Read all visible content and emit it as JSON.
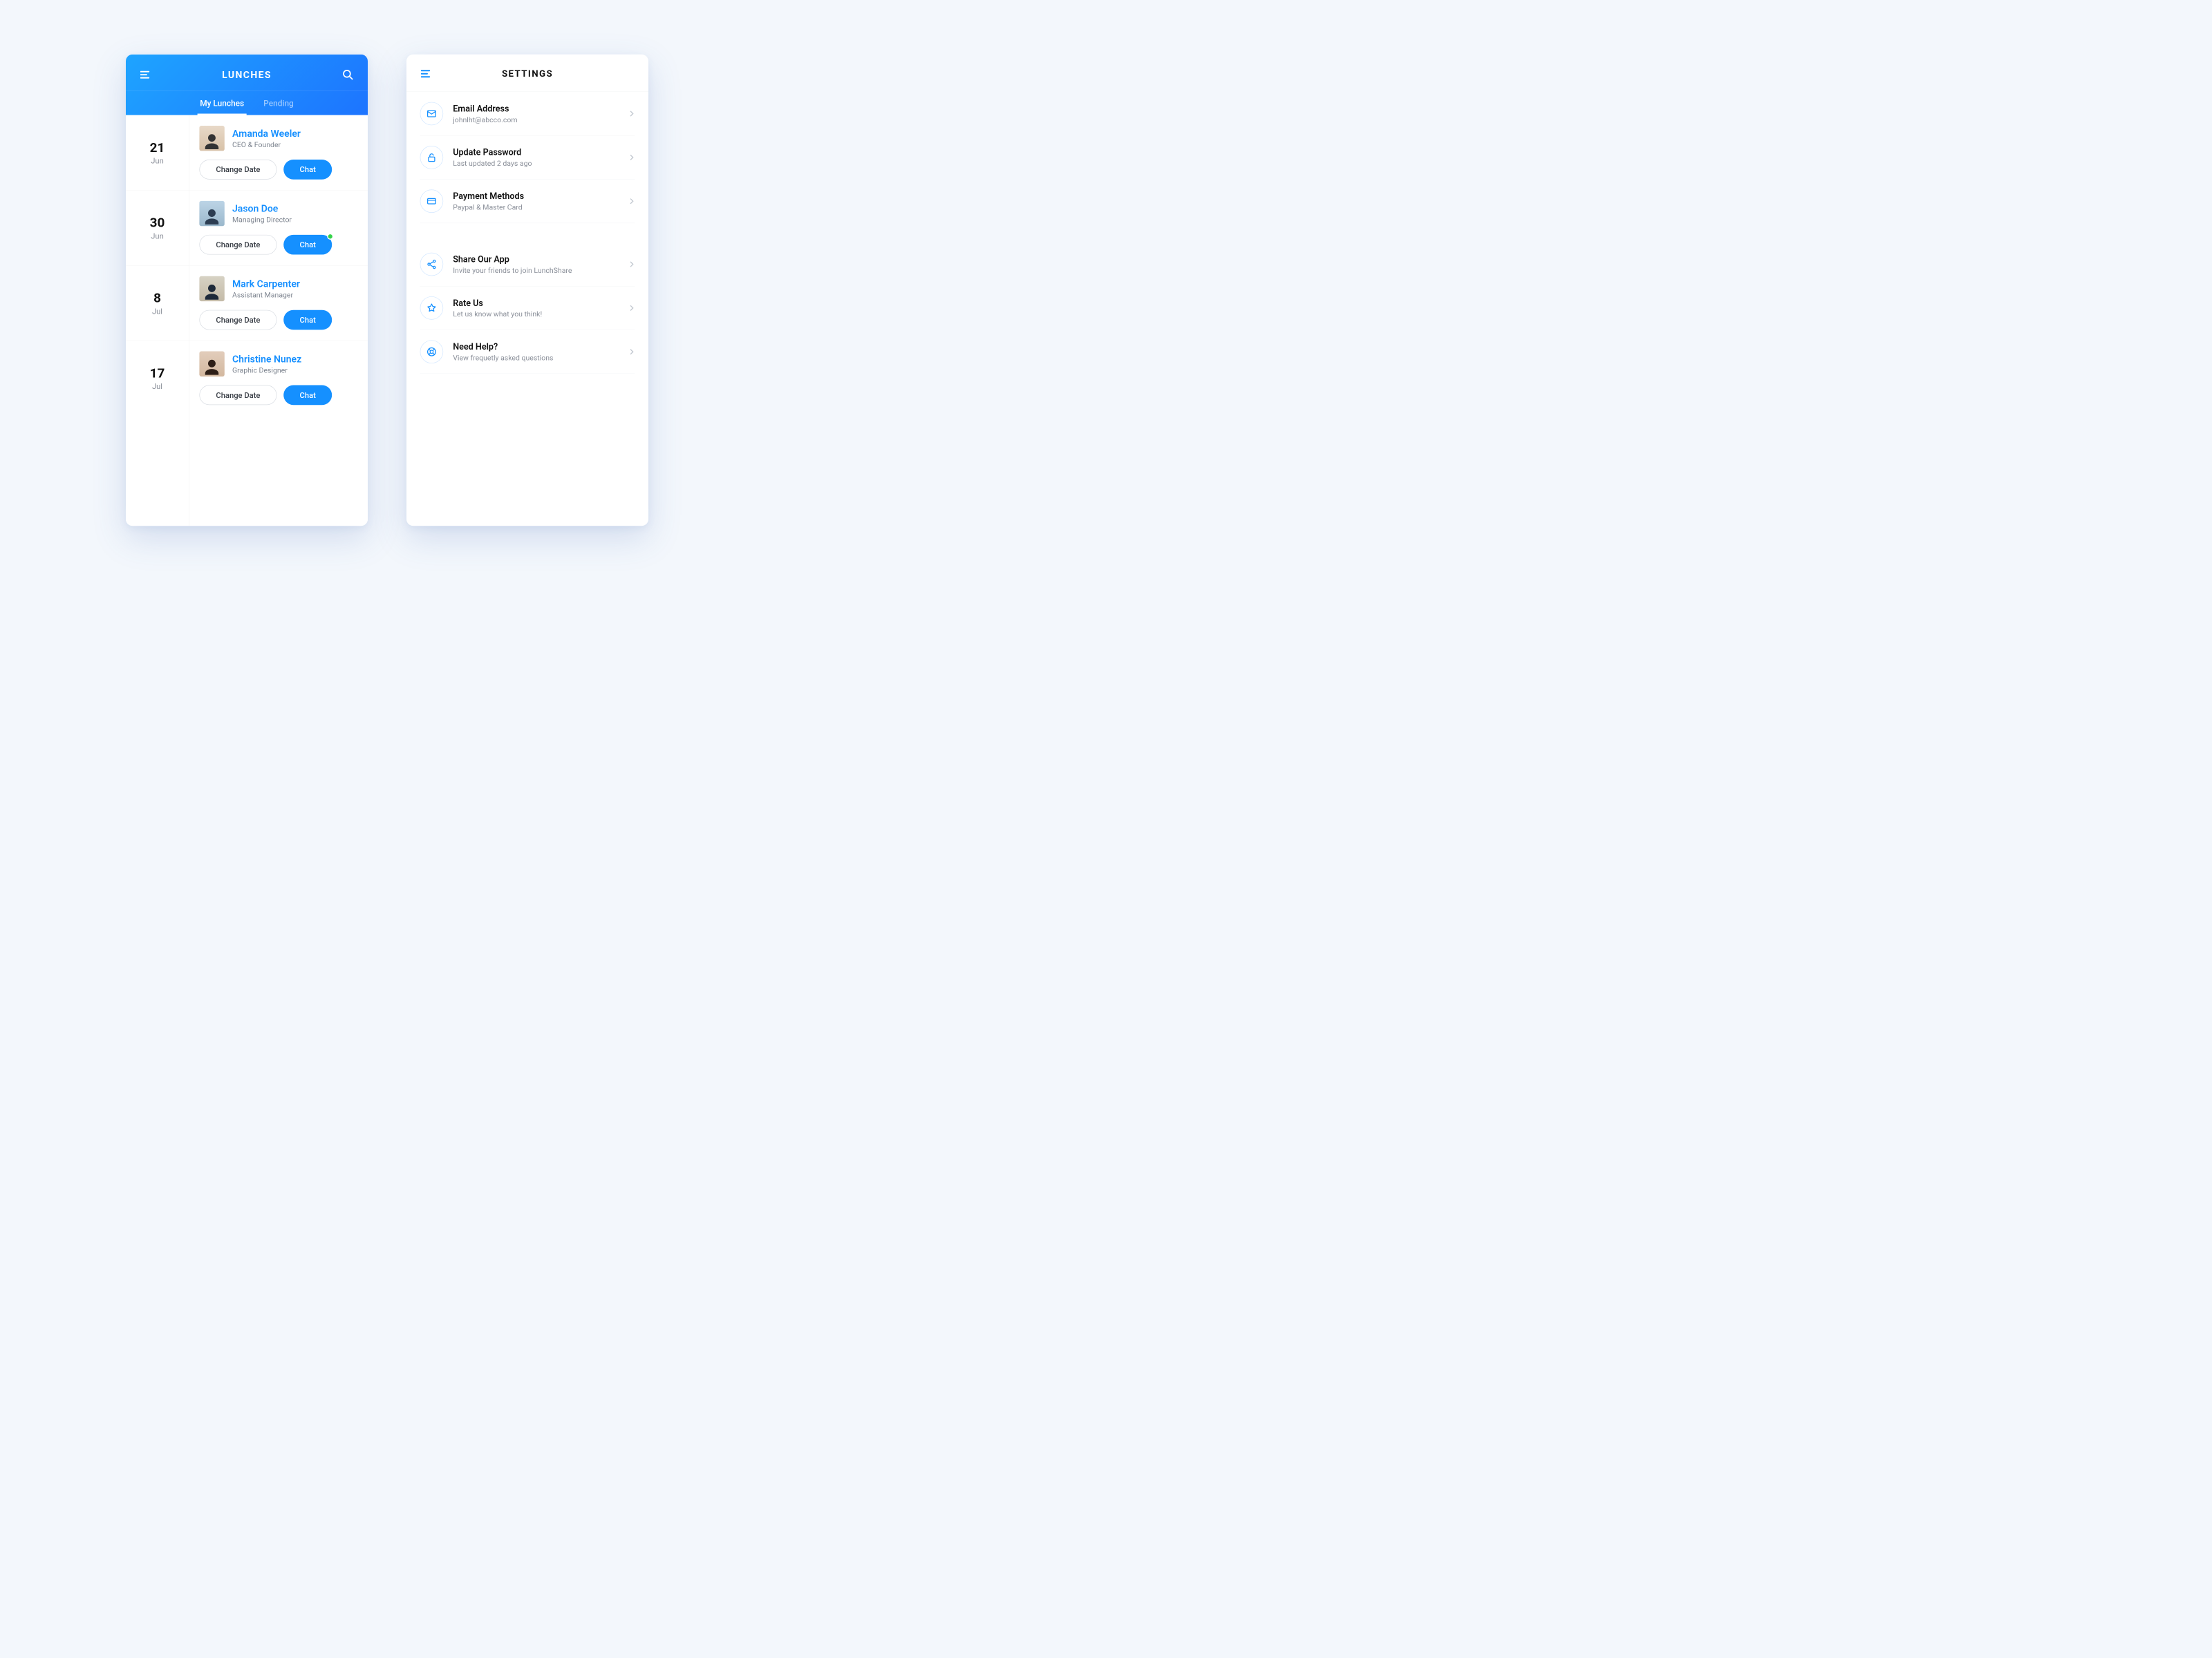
{
  "lunches": {
    "title": "LUNCHES",
    "tabs": {
      "my_lunches": "My Lunches",
      "pending": "Pending"
    },
    "change_date_label": "Change Date",
    "chat_label": "Chat",
    "items": [
      {
        "day": "21",
        "month": "Jun",
        "name": "Amanda Weeler",
        "role": "CEO & Founder",
        "has_badge": false
      },
      {
        "day": "30",
        "month": "Jun",
        "name": "Jason Doe",
        "role": "Managing Director",
        "has_badge": true
      },
      {
        "day": "8",
        "month": "Jul",
        "name": "Mark Carpenter",
        "role": "Assistant Manager",
        "has_badge": false
      },
      {
        "day": "17",
        "month": "Jul",
        "name": "Christine Nunez",
        "role": "Graphic Designer",
        "has_badge": false
      }
    ]
  },
  "settings": {
    "title": "SETTINGS",
    "group1": [
      {
        "icon": "mail-icon",
        "title": "Email Address",
        "sub": "johnlht@abcco.com"
      },
      {
        "icon": "lock-icon",
        "title": "Update Password",
        "sub": "Last updated 2 days ago"
      },
      {
        "icon": "card-icon",
        "title": "Payment Methods",
        "sub": "Paypal & Master Card"
      }
    ],
    "group2": [
      {
        "icon": "share-icon",
        "title": "Share Our App",
        "sub": "Invite your friends to join LunchShare"
      },
      {
        "icon": "star-icon",
        "title": "Rate Us",
        "sub": "Let us know what you think!"
      },
      {
        "icon": "help-icon",
        "title": "Need Help?",
        "sub": "View frequetly asked questions"
      }
    ]
  }
}
